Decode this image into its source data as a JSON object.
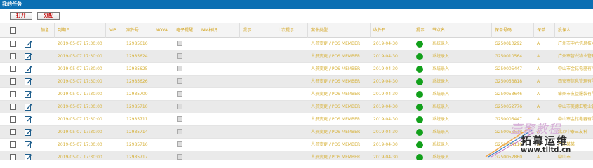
{
  "window": {
    "title": "我的任务"
  },
  "toolbar": {
    "open_label": "打开",
    "assign_label": "分配"
  },
  "columns": [
    "加急",
    "到期日",
    "VIP",
    "案件号",
    "NOVA",
    "电子提醒",
    "MM标识",
    "提示",
    "上次提示",
    "案件类型",
    "收件日",
    "提示",
    "节点名",
    "保单号码",
    "保单...",
    "投保人"
  ],
  "rows": [
    {
      "due": "2019-05-07 17:30:00",
      "case": "12985616",
      "type": "人员变更 / POS MEMBER",
      "recv": "2019-04-30",
      "node": "系统录入",
      "policy": "G250010292",
      "flag": "A",
      "holder": "广州市中六信息技术"
    },
    {
      "due": "2019-05-07 17:30:00",
      "case": "12985624",
      "type": "人员变更 / POS MEMBER",
      "recv": "2019-04-30",
      "node": "系统录入",
      "policy": "G250010564",
      "flag": "A",
      "holder": "广州市智兴物业管理"
    },
    {
      "due": "2019-05-07 17:30:00",
      "case": "12985625",
      "type": "人员变更 / POS MEMBER",
      "recv": "2019-04-30",
      "node": "系统录入",
      "policy": "G250005447",
      "flag": "A",
      "holder": "中山市金钇电器有限"
    },
    {
      "due": "2019-05-07 17:30:00",
      "case": "12985626",
      "type": "人员变更 / POS MEMBER",
      "recv": "2019-04-30",
      "node": "系统录入",
      "policy": "G250053818",
      "flag": "A",
      "holder": "西安市信息管理有限"
    },
    {
      "due": "2019-05-07 17:30:00",
      "case": "12985700",
      "type": "人员变更 / POS MEMBER",
      "recv": "2019-04-30",
      "node": "系统录入",
      "policy": "G250053646",
      "flag": "A",
      "holder": "肇州市友益服装有限"
    },
    {
      "due": "2019-05-07 17:30:00",
      "case": "12985710",
      "type": "人员变更 / POS MEMBER",
      "recv": "2019-04-30",
      "node": "系统录入",
      "policy": "G250052776",
      "flag": "A",
      "holder": "中山市美德汇物业管"
    },
    {
      "due": "2019-05-07 17:30:00",
      "case": "12985711",
      "type": "人员变更 / POS MEMBER",
      "recv": "2019-04-30",
      "node": "系统录入",
      "policy": "G250005447",
      "flag": "A",
      "holder": "中山市金钇电器有限"
    },
    {
      "due": "2019-05-07 17:30:00",
      "case": "12985714",
      "type": "人员变更 / POS MEMBER",
      "recv": "2019-04-30",
      "node": "系统录入",
      "policy": "G250053618",
      "flag": "A",
      "holder": "北京中泰三友科"
    },
    {
      "due": "2019-05-07 17:30:00",
      "case": "12985716",
      "type": "人员变更 / POS MEMBER",
      "recv": "2019-04-30",
      "node": "系统录入",
      "policy": "G250054110",
      "flag": "A",
      "holder": "广州某某"
    },
    {
      "due": "2019-05-07 17:30:00",
      "case": "12985717",
      "type": "人员变更 / POS MEMBER",
      "recv": "2019-04-30",
      "node": "系统录入",
      "policy": "G250052860",
      "flag": "A",
      "holder": "中山市"
    }
  ],
  "watermark": {
    "line1": "壹聚教程",
    "line2": "拓幕运维",
    "line3": "www.tlltd.cn"
  },
  "colors": {
    "header": "#0b6fb3",
    "text": "#d7b23a",
    "status": "#12a01b"
  },
  "icons": {
    "edit": "edit-icon",
    "status": "status-dot-icon"
  }
}
